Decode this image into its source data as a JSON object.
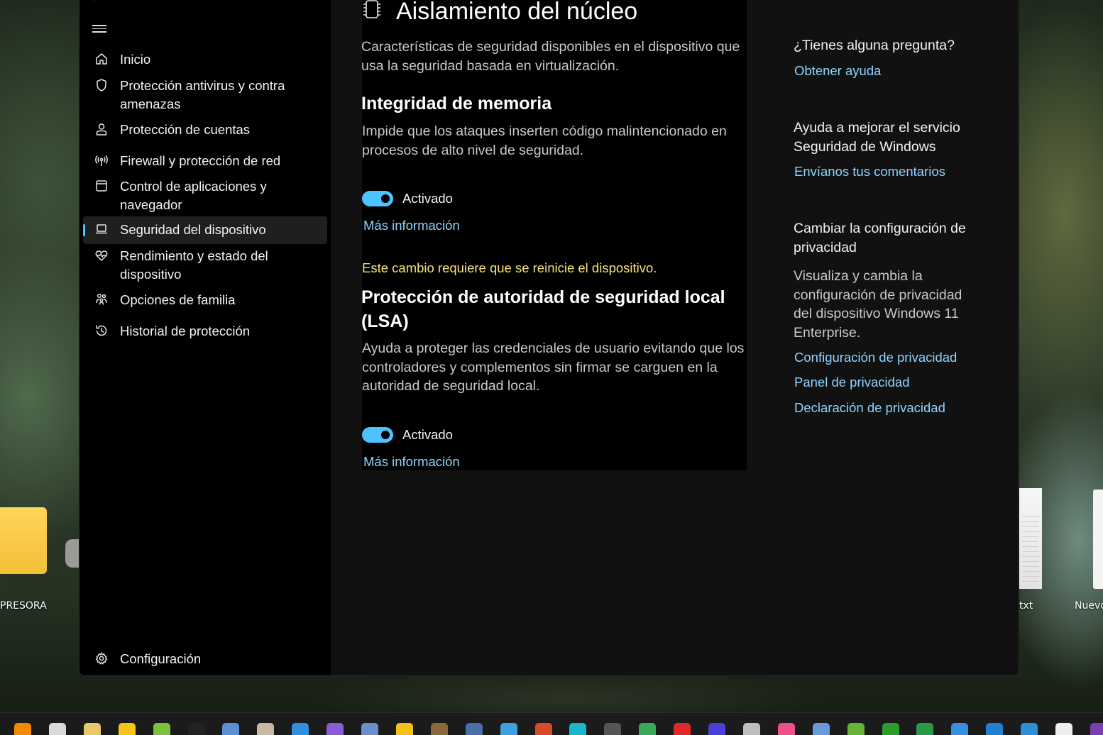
{
  "desktop": {
    "left_label": "PRESORA",
    "right_label_1": "txt",
    "right_label_2": "Nuevo"
  },
  "sidebar": {
    "items": [
      {
        "label": "Inicio",
        "icon": "home-icon"
      },
      {
        "label": "Protección antivirus y contra amenazas",
        "icon": "shield-icon"
      },
      {
        "label": "Protección de cuentas",
        "icon": "person-icon"
      },
      {
        "label": "Firewall y protección de red",
        "icon": "wireless-icon"
      },
      {
        "label": "Control de aplicaciones y navegador",
        "icon": "app-browser-icon"
      },
      {
        "label": "Seguridad del dispositivo",
        "icon": "laptop-icon",
        "active": true
      },
      {
        "label": "Rendimiento y estado del dispositivo",
        "icon": "heart-pulse-icon"
      },
      {
        "label": "Opciones de familia",
        "icon": "family-icon"
      },
      {
        "label": "Historial de protección",
        "icon": "history-icon"
      }
    ],
    "settings_label": "Configuración"
  },
  "main": {
    "title": "Aislamiento del núcleo",
    "description": "Características de seguridad disponibles en el dispositivo que usa la seguridad basada en virtualización.",
    "memory_integrity": {
      "heading": "Integridad de memoria",
      "description": "Impide que los ataques inserten código malintencionado en procesos de alto nivel de seguridad.",
      "toggle_state": "Activado",
      "more_info": "Más información",
      "warning": "Este cambio requiere que se reinicie el dispositivo."
    },
    "lsa": {
      "heading": "Protección de autoridad de seguridad local (LSA)",
      "description": "Ayuda a proteger las credenciales de usuario evitando que los controladores y complementos sin firmar se carguen en la autoridad de seguridad local.",
      "toggle_state": "Activado",
      "more_info": "Más información"
    }
  },
  "right_panel": {
    "question_heading": "¿Tienes alguna pregunta?",
    "get_help": "Obtener ayuda",
    "improve_heading": "Ayuda a mejorar el servicio Seguridad de Windows",
    "send_feedback": "Envíanos tus comentarios",
    "privacy_heading": "Cambiar la configuración de privacidad",
    "privacy_description": "Visualiza y cambia la configuración de privacidad del dispositivo Windows 11 Enterprise.",
    "privacy_settings": "Configuración de privacidad",
    "privacy_dashboard": "Panel de privacidad",
    "privacy_statement": "Declaración de privacidad"
  },
  "taskbar": {
    "icons": [
      {
        "name": "vlc-icon",
        "color": "#f08a00"
      },
      {
        "name": "video-editor-icon",
        "color": "#d9d9d9"
      },
      {
        "name": "pencil-app-icon",
        "color": "#e8c86a"
      },
      {
        "name": "warning-app-icon",
        "color": "#f5c518"
      },
      {
        "name": "green-app-icon",
        "color": "#7fbf3f"
      },
      {
        "name": "pluto-tv-icon",
        "color": "#222222"
      },
      {
        "name": "qbittorrent-icon",
        "color": "#5b8fd6"
      },
      {
        "name": "rabbit-app-icon",
        "color": "#c9b9a4"
      },
      {
        "name": "vscode-icon",
        "color": "#2f8fe0"
      },
      {
        "name": "visual-studio-icon",
        "color": "#8a5cd6"
      },
      {
        "name": "library-app-icon",
        "color": "#6a8fc9"
      },
      {
        "name": "cfe-app-icon",
        "color": "#f3c21a"
      },
      {
        "name": "sphere-app-icon",
        "color": "#8a6a3a"
      },
      {
        "name": "orb-app-icon",
        "color": "#4a6ea8"
      },
      {
        "name": "globe-app-icon",
        "color": "#3fa0e0"
      },
      {
        "name": "red-app-icon",
        "color": "#d94a2a"
      },
      {
        "name": "canva-icon",
        "color": "#19b8c9"
      },
      {
        "name": "camera-app-icon",
        "color": "#555555"
      },
      {
        "name": "chrome-icon",
        "color": "#3aa75a"
      },
      {
        "name": "record-app-icon",
        "color": "#e02a2a"
      },
      {
        "name": "firefox-icon",
        "color": "#4a3fd6"
      },
      {
        "name": "svg-app-icon",
        "color": "#bdbdbd"
      },
      {
        "name": "media-player-icon",
        "color": "#f0508a"
      },
      {
        "name": "photo-app-icon",
        "color": "#6a9bd6"
      },
      {
        "name": "shield-app-icon",
        "color": "#66b23a"
      },
      {
        "name": "xbox-icon",
        "color": "#2d9b2d"
      },
      {
        "name": "64-app-icon",
        "color": "#2a9a4a"
      },
      {
        "name": "notepad-icon",
        "color": "#3a8ee0"
      },
      {
        "name": "remote-app-icon",
        "color": "#1f7fd0"
      },
      {
        "name": "store-icon",
        "color": "#2f8fd6"
      },
      {
        "name": "file-icon",
        "color": "#eeeeee"
      },
      {
        "name": "onenote-icon",
        "color": "#7a3fb2"
      }
    ]
  },
  "colors": {
    "accent": "#4cc2ff",
    "link": "#8fd3ff",
    "warning": "#f7e07a"
  }
}
